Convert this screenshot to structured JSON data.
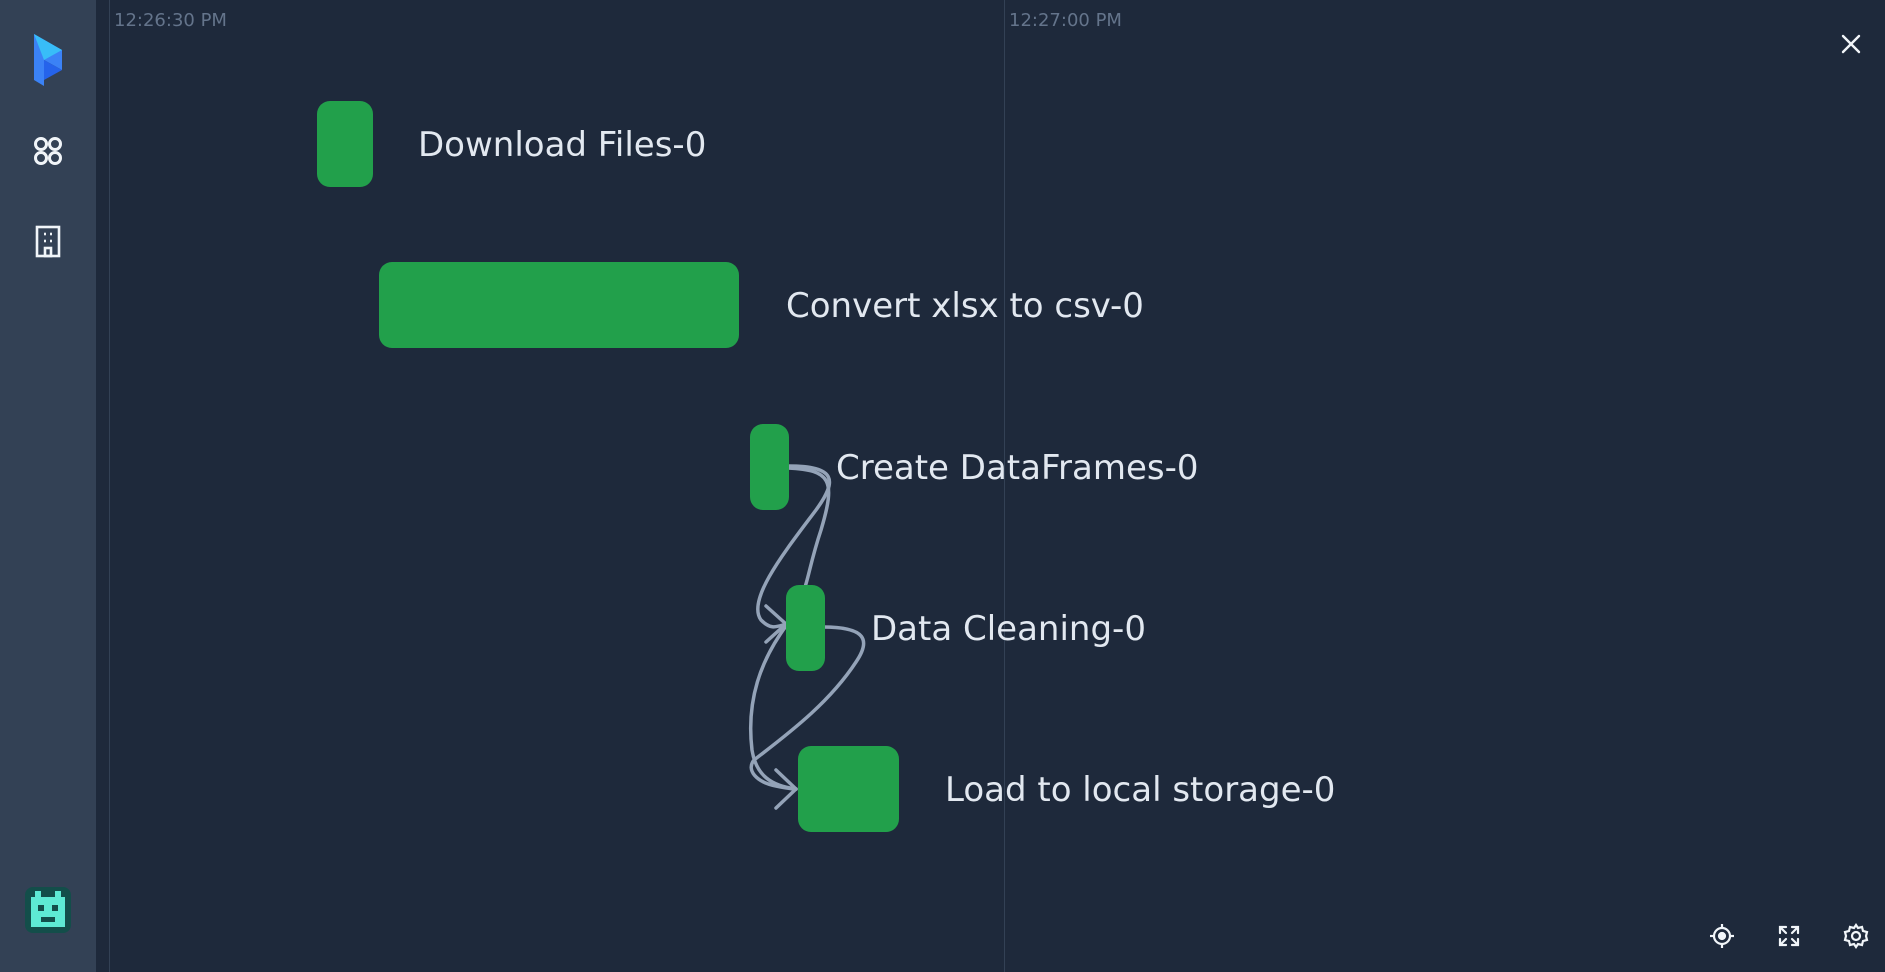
{
  "sidebar": {
    "logo_icon": "prefect-logo-icon",
    "items": [
      {
        "icon": "grid-icon"
      },
      {
        "icon": "building-icon"
      }
    ],
    "avatar_icon": "pixel-avatar-icon"
  },
  "timeline": {
    "ticks": [
      "12:26:30 PM",
      "12:27:00 PM"
    ]
  },
  "nodes": [
    {
      "label": "Download Files-0",
      "state": "completed"
    },
    {
      "label": "Convert xlsx to csv-0",
      "state": "completed"
    },
    {
      "label": "Create DataFrames-0",
      "state": "completed"
    },
    {
      "label": "Data Cleaning-0",
      "state": "completed"
    },
    {
      "label": "Load to local storage-0",
      "state": "completed"
    }
  ],
  "controls": {
    "close_icon": "close-icon",
    "recenter_icon": "target-icon",
    "fullscreen_icon": "fullscreen-icon",
    "settings_icon": "gear-icon"
  },
  "colors": {
    "completed": "#22a04b",
    "background": "#1e293b",
    "sidebar": "#334155",
    "edge": "#94a3b8",
    "label": "#e2e8f0"
  }
}
